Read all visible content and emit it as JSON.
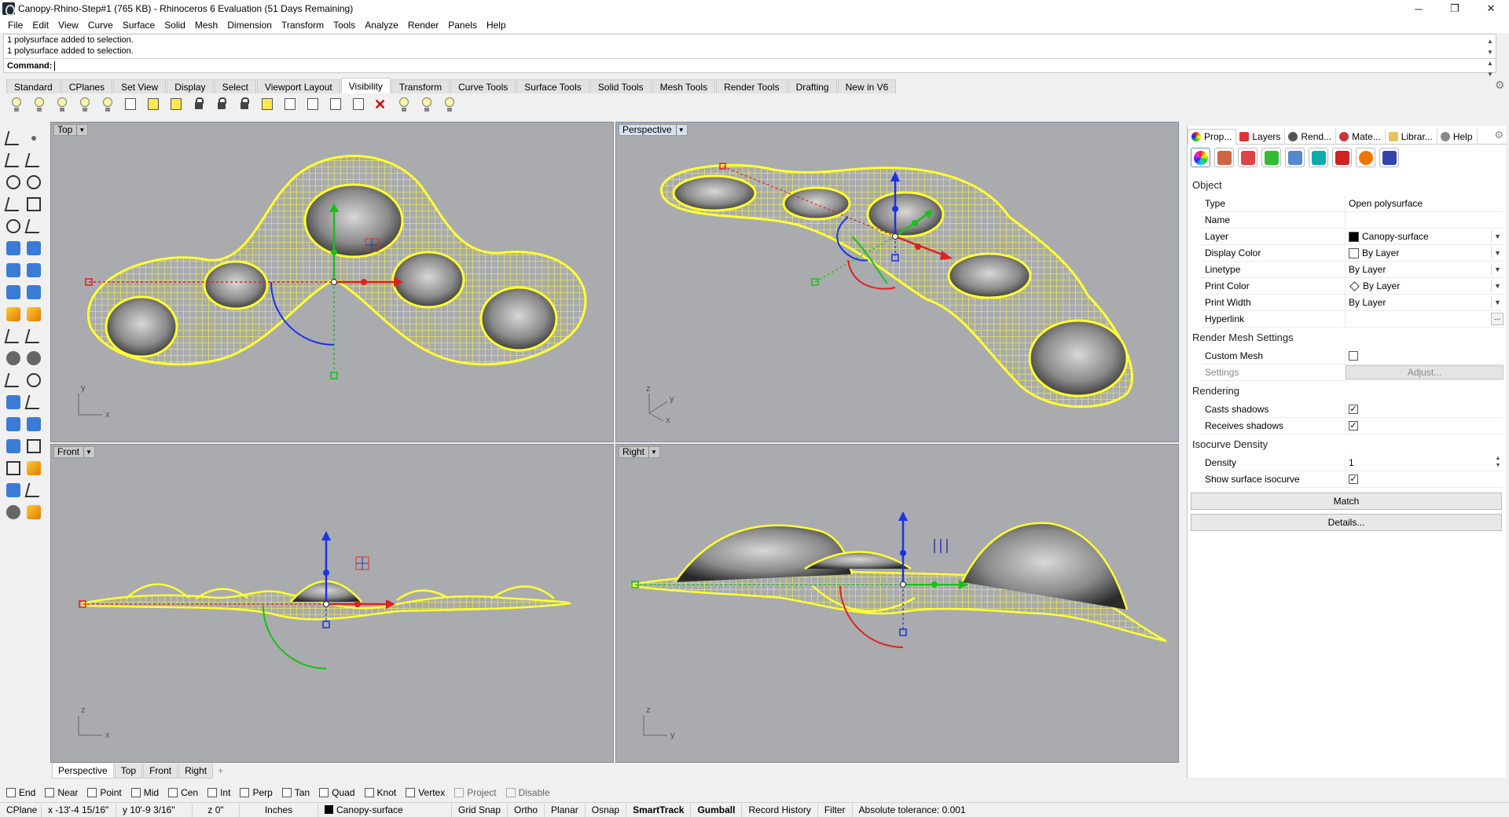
{
  "window": {
    "title": "Canopy-Rhino-Step#1 (765 KB) - Rhinoceros 6 Evaluation (51 Days Remaining)",
    "controls": {
      "minimize": "─",
      "restore": "❐",
      "close": "✕"
    }
  },
  "menu": [
    "File",
    "Edit",
    "View",
    "Curve",
    "Surface",
    "Solid",
    "Mesh",
    "Dimension",
    "Transform",
    "Tools",
    "Analyze",
    "Render",
    "Panels",
    "Help"
  ],
  "command": {
    "history": [
      "1 polysurface added to selection.",
      "1 polysurface added to selection."
    ],
    "label": "Command:",
    "value": ""
  },
  "toolbar_tabs": {
    "items": [
      "Standard",
      "CPlanes",
      "Set View",
      "Display",
      "Select",
      "Viewport Layout",
      "Visibility",
      "Transform",
      "Curve Tools",
      "Surface Tools",
      "Solid Tools",
      "Mesh Tools",
      "Render Tools",
      "Drafting",
      "New in V6"
    ],
    "active": "Visibility"
  },
  "viewports": {
    "top": {
      "label": "Top",
      "axis_a": "y",
      "axis_b": "x"
    },
    "perspective": {
      "label": "Perspective",
      "axis_a": "z",
      "axis_b": "y",
      "axis_c": "x"
    },
    "front": {
      "label": "Front",
      "axis_a": "z",
      "axis_b": "x"
    },
    "right": {
      "label": "Right",
      "axis_a": "z",
      "axis_b": "y"
    }
  },
  "viewport_tabs": {
    "items": [
      "Perspective",
      "Top",
      "Front",
      "Right"
    ],
    "active": "Perspective",
    "add": "+"
  },
  "osnap": [
    {
      "label": "End",
      "checked": false,
      "enabled": true
    },
    {
      "label": "Near",
      "checked": false,
      "enabled": true
    },
    {
      "label": "Point",
      "checked": false,
      "enabled": true
    },
    {
      "label": "Mid",
      "checked": false,
      "enabled": true
    },
    {
      "label": "Cen",
      "checked": false,
      "enabled": true
    },
    {
      "label": "Int",
      "checked": false,
      "enabled": true
    },
    {
      "label": "Perp",
      "checked": false,
      "enabled": true
    },
    {
      "label": "Tan",
      "checked": false,
      "enabled": true
    },
    {
      "label": "Quad",
      "checked": false,
      "enabled": true
    },
    {
      "label": "Knot",
      "checked": false,
      "enabled": true
    },
    {
      "label": "Vertex",
      "checked": false,
      "enabled": true
    },
    {
      "label": "Project",
      "checked": false,
      "enabled": false
    },
    {
      "label": "Disable",
      "checked": false,
      "enabled": false
    }
  ],
  "status": {
    "cplane": "CPlane",
    "x": "x -13'-4 15/16\"",
    "y": "y 10'-9 3/16\"",
    "z": "z 0\"",
    "units": "Inches",
    "layer": "Canopy-surface",
    "grid_snap": "Grid Snap",
    "ortho": "Ortho",
    "planar": "Planar",
    "osnap": "Osnap",
    "smarttrack": "SmartTrack",
    "gumball": "Gumball",
    "record_history": "Record History",
    "filter": "Filter",
    "tolerance": "Absolute tolerance: 0.001"
  },
  "panel": {
    "tabs": [
      "Prop...",
      "Layers",
      "Rend...",
      "Mate...",
      "Librar...",
      "Help"
    ],
    "active_tab": "Prop...",
    "object": {
      "heading": "Object",
      "type_label": "Type",
      "type_value": "Open polysurface",
      "name_label": "Name",
      "name_value": "",
      "layer_label": "Layer",
      "layer_value": "Canopy-surface",
      "display_color_label": "Display Color",
      "display_color_value": "By Layer",
      "linetype_label": "Linetype",
      "linetype_value": "By Layer",
      "print_color_label": "Print Color",
      "print_color_value": "By Layer",
      "print_width_label": "Print Width",
      "print_width_value": "By Layer",
      "hyperlink_label": "Hyperlink",
      "hyperlink_value": "",
      "more": "..."
    },
    "render_mesh": {
      "heading": "Render Mesh Settings",
      "custom_mesh_label": "Custom Mesh",
      "custom_mesh_checked": false,
      "settings_label": "Settings",
      "adjust_label": "Adjust..."
    },
    "rendering": {
      "heading": "Rendering",
      "casts_label": "Casts shadows",
      "casts_checked": true,
      "receives_label": "Receives shadows",
      "receives_checked": true
    },
    "isocurve": {
      "heading": "Isocurve Density",
      "density_label": "Density",
      "density_value": "1",
      "show_label": "Show surface isocurve",
      "show_checked": true
    },
    "match_button": "Match",
    "details_button": "Details..."
  },
  "colors": {
    "viewport_bg": "#a9abae",
    "wire": "#ffff33",
    "axis_x": "#e02020",
    "axis_y": "#18c018",
    "axis_z": "#1a33e6",
    "layer_swatch": "#000000"
  }
}
